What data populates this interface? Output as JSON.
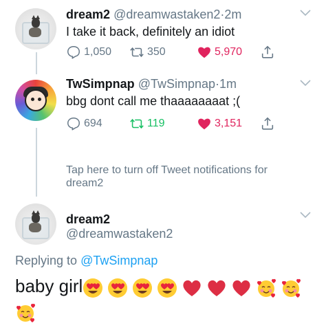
{
  "tweets": [
    {
      "name": "dream2",
      "handle": "@dreamwastaken2",
      "sep": "·",
      "time": "2m",
      "text": "I take it back, definitely an idiot",
      "replies": "1,050",
      "retweets": "350",
      "likes": "5,970"
    },
    {
      "name": "TwSimpnap",
      "handle": "@TwSimpnap",
      "sep": "·",
      "time": "1m",
      "text": "bbg dont call me thaaaaaaaat ;(",
      "replies": "694",
      "retweets": "119",
      "likes": "3,151"
    }
  ],
  "notification_note": "Tap here to turn off Tweet notifications for dream2",
  "focused": {
    "name": "dream2",
    "handle": "@dreamwastaken2",
    "replying_prefix": "Replying to",
    "replying_to": "@TwSimpnap",
    "text": "baby girl"
  },
  "colors": {
    "like": "#e0245e",
    "retweet_active": "#17bf63",
    "muted": "#657786",
    "link": "#1da1f2"
  },
  "icons": [
    "chevron-down-icon",
    "reply-icon",
    "retweet-icon",
    "heart-icon",
    "share-icon"
  ],
  "emojis": [
    "heart-eyes",
    "heart-eyes",
    "heart-eyes",
    "heart-eyes",
    "red-heart",
    "red-heart",
    "red-heart",
    "smiling-face-with-hearts",
    "smiling-face-with-hearts",
    "smiling-face-with-hearts"
  ]
}
